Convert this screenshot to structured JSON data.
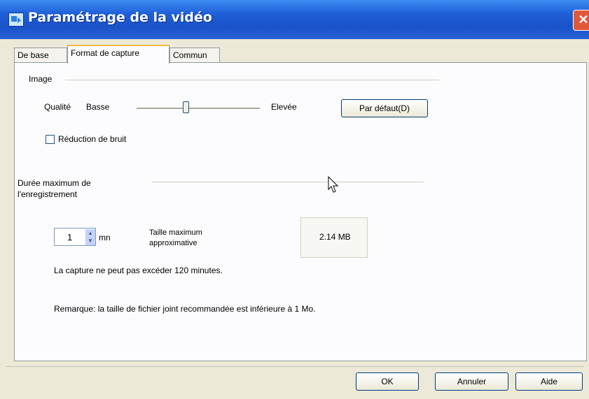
{
  "window": {
    "title": "Paramétrage de la vidéo",
    "close_label": "✕"
  },
  "tabs": [
    {
      "label": "De base"
    },
    {
      "label": "Format de capture"
    },
    {
      "label": "Commun"
    }
  ],
  "image_section": {
    "heading": "Image",
    "quality_label": "Qualité",
    "low_label": "Basse",
    "high_label": "Elevée",
    "quality_level_fraction": 0.4,
    "default_button": "Par défaut(D)",
    "noise_reduction_label": "Réduction de bruit",
    "noise_reduction_checked": false
  },
  "duration_section": {
    "heading_line1": "Durée maximum de",
    "heading_line2": "l'enregistrement",
    "minutes_value": "1",
    "minutes_unit": "mn",
    "size_label_line1": "Taille maximum",
    "size_label_line2": "approximative",
    "size_value": "2.14 MB",
    "limit_note": "La capture ne peut pas excéder 120 minutes.",
    "remark": "Remarque: la taille de fichier joint recommandée est inférieure à 1 Mo."
  },
  "footer": {
    "ok": "OK",
    "cancel": "Annuler",
    "help": "Aide"
  },
  "colors": {
    "titlebar": "#1f5fd8",
    "dialog_bg": "#ece9d8",
    "panel_bg": "#fcfcfe",
    "active_tab_accent": "#f5b93b",
    "close_button": "#e2573a"
  }
}
